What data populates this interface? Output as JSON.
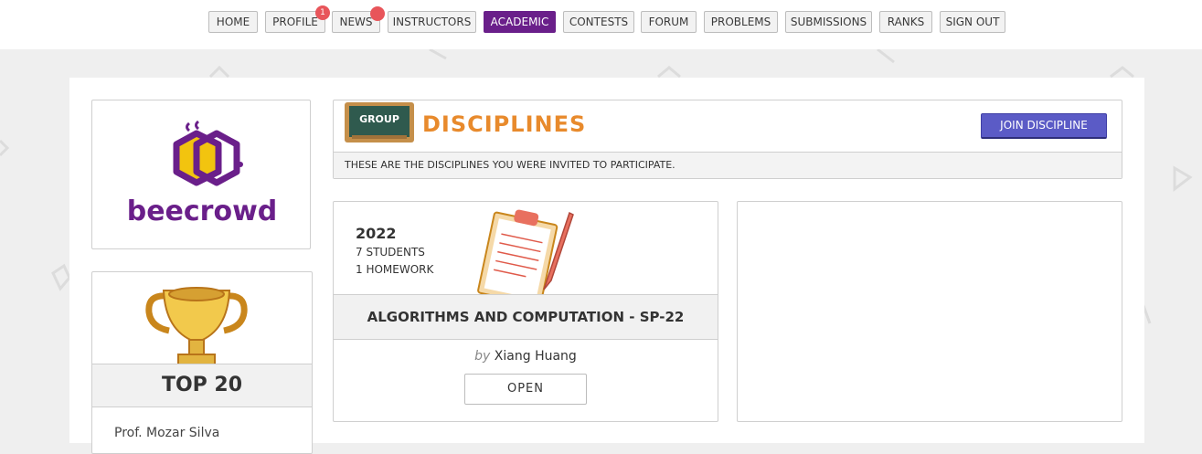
{
  "nav": {
    "items": [
      {
        "label": "HOME"
      },
      {
        "label": "PROFILE",
        "badge": "1"
      },
      {
        "label": "NEWS"
      },
      {
        "label": "INSTRUCTORS"
      },
      {
        "label": "ACADEMIC",
        "active": true
      },
      {
        "label": "CONTESTS"
      },
      {
        "label": "FORUM"
      },
      {
        "label": "PROBLEMS"
      },
      {
        "label": "SUBMISSIONS"
      },
      {
        "label": "RANKS"
      },
      {
        "label": "SIGN OUT"
      }
    ]
  },
  "sidebar": {
    "logo_text": "beecrowd",
    "top_title": "TOP 20",
    "top_first": "Prof. Mozar Silva"
  },
  "disciplines": {
    "title": "DISCIPLINES",
    "board_text": "GROUP",
    "join_label": "JOIN DISCIPLINE",
    "subtitle": "THESE ARE THE DISCIPLINES YOU WERE INVITED TO PARTICIPATE."
  },
  "course": {
    "year": "2022",
    "students": "7 STUDENTS",
    "homework": "1 HOMEWORK",
    "title": "ALGORITHMS AND COMPUTATION - SP-22",
    "by": "by",
    "instructor": "Xiang Huang",
    "open_label": "OPEN"
  },
  "colors": {
    "accent": "#6a1f8a",
    "title_orange": "#e88a2c",
    "join_button": "#5b5bc6",
    "badge": "#e8555a"
  }
}
